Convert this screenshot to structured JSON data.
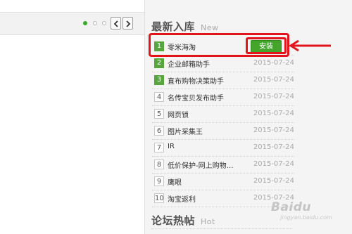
{
  "carousel": {
    "dots": [
      "active",
      "inactive",
      "inactive"
    ]
  },
  "sections": {
    "new_apps": {
      "title": "最新入库",
      "subtitle": "New"
    },
    "forum": {
      "title": "论坛热帖",
      "subtitle": "Hot"
    }
  },
  "app_list": [
    {
      "rank": "1",
      "name": "零米海淘",
      "date": "",
      "action": "安装"
    },
    {
      "rank": "2",
      "name": "企业邮箱助手",
      "date": "2015-07-24",
      "action": ""
    },
    {
      "rank": "3",
      "name": "直布购物决策助手",
      "date": "2015-07-24",
      "action": ""
    },
    {
      "rank": "4",
      "name": "名传宝贝发布助手",
      "date": "2015-07-24",
      "action": ""
    },
    {
      "rank": "5",
      "name": "网页锁",
      "date": "2015-07-24",
      "action": ""
    },
    {
      "rank": "6",
      "name": "图片采集王",
      "date": "2015-07-24",
      "action": ""
    },
    {
      "rank": "7",
      "name": "IR",
      "date": "2015-07-24",
      "action": ""
    },
    {
      "rank": "8",
      "name": "低价保护-网上购物…",
      "date": "2015-07-24",
      "action": ""
    },
    {
      "rank": "9",
      "name": "鹰眼",
      "date": "2015-07-24",
      "action": ""
    },
    {
      "rank": "10",
      "name": "淘宝返利",
      "date": "2015-07-24",
      "action": ""
    }
  ],
  "watermark": {
    "brand": "Baidu",
    "sub": "jingyan.baidu.com"
  },
  "colors": {
    "accent_green": "#44a52b",
    "highlight_red": "#e2141b"
  }
}
